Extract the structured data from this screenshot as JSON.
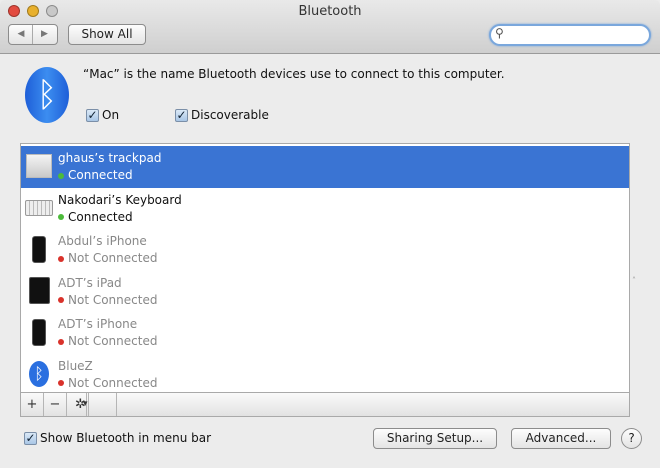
{
  "window": {
    "title": "Bluetooth"
  },
  "toolbar": {
    "back": "◀",
    "forward": "▶",
    "show_all": "Show All",
    "search_value": "",
    "search_placeholder": ""
  },
  "header": {
    "description": "“Mac” is the name Bluetooth devices use to connect to this computer.",
    "on_label": "On",
    "on_checked": true,
    "discoverable_label": "Discoverable",
    "discoverable_checked": true
  },
  "devices": [
    {
      "name": "ghaus’s trackpad",
      "status": "Connected",
      "connected": true,
      "selected": true,
      "icon": "trackpad-icon"
    },
    {
      "name": "Nakodari’s Keyboard",
      "status": "Connected",
      "connected": true,
      "selected": false,
      "icon": "keyboard-icon"
    },
    {
      "name": "Abdul’s iPhone",
      "status": "Not Connected",
      "connected": false,
      "selected": false,
      "icon": "iphone-icon"
    },
    {
      "name": "ADT’s iPad",
      "status": "Not Connected",
      "connected": false,
      "selected": false,
      "icon": "ipad-icon"
    },
    {
      "name": "ADT’s iPhone",
      "status": "Not Connected",
      "connected": false,
      "selected": false,
      "icon": "iphone-icon"
    },
    {
      "name": "BlueZ",
      "status": "Not Connected",
      "connected": false,
      "selected": false,
      "icon": "bluetooth-icon"
    }
  ],
  "list_bar": {
    "add": "+",
    "remove": "−",
    "gear": "✲",
    "menu": "▾"
  },
  "footer": {
    "show_in_menu_bar_label": "Show Bluetooth in menu bar",
    "show_in_menu_bar_checked": true,
    "sharing_setup": "Sharing Setup...",
    "advanced": "Advanced...",
    "help": "?"
  },
  "colors": {
    "selection": "#3a74d3",
    "connected": "#4cbb3a",
    "not_connected": "#d9322b"
  }
}
